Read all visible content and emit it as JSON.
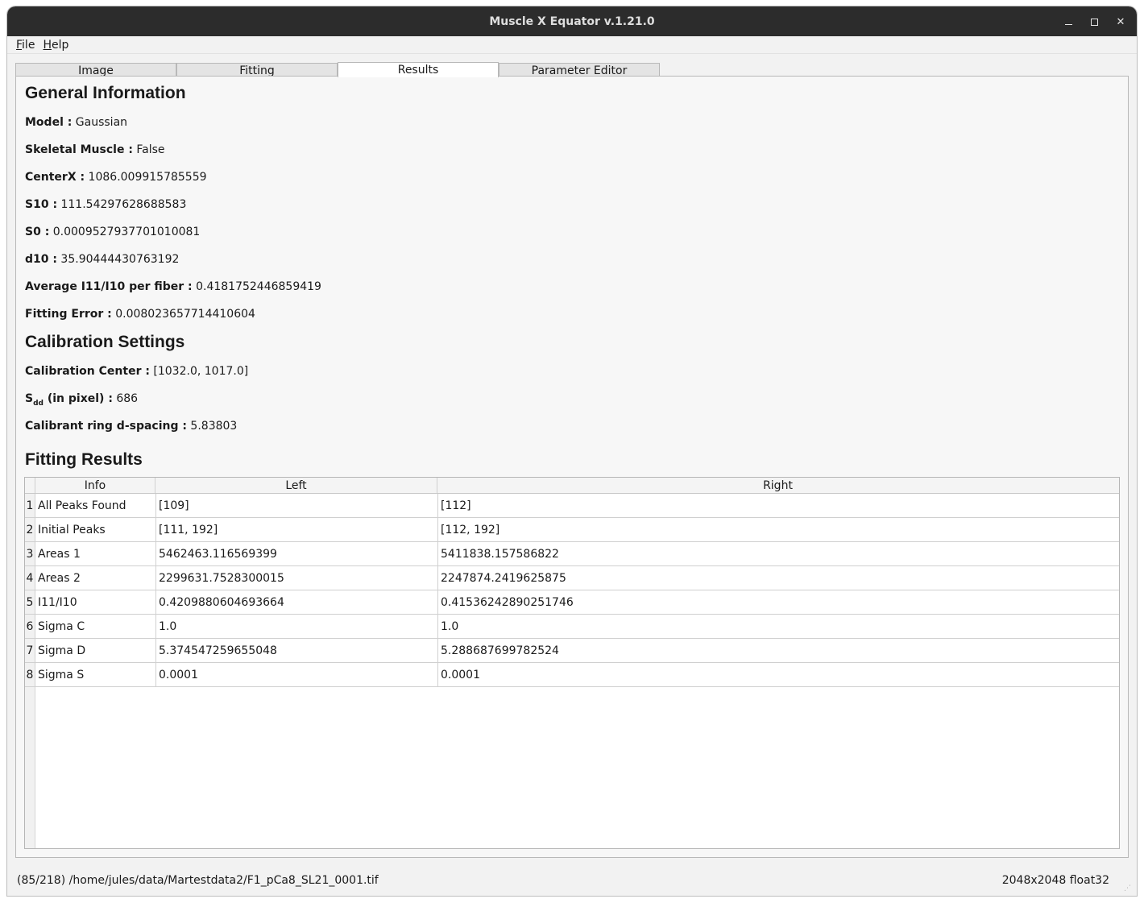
{
  "window": {
    "title": "Muscle X Equator v.1.21.0"
  },
  "menubar": {
    "items": [
      {
        "label": "File",
        "mnemonic": "F",
        "rest": "ile"
      },
      {
        "label": "Help",
        "mnemonic": "H",
        "rest": "elp"
      }
    ]
  },
  "tabs": [
    {
      "label": "Image",
      "active": false
    },
    {
      "label": "Fitting",
      "active": false
    },
    {
      "label": "Results",
      "active": true
    },
    {
      "label": "Parameter Editor",
      "active": false
    }
  ],
  "general": {
    "heading": "General Information",
    "items": [
      {
        "key": "Model :",
        "value": " Gaussian"
      },
      {
        "key": "Skeletal Muscle :",
        "value": " False"
      },
      {
        "key": "CenterX :",
        "value": " 1086.009915785559"
      },
      {
        "key": "S10 :",
        "value": " 111.54297628688583"
      },
      {
        "key": "S0 :",
        "value": " 0.0009527937701010081"
      },
      {
        "key": "d10 :",
        "value": " 35.90444430763192"
      },
      {
        "key": "Average I11/I10 per fiber :",
        "value": " 0.4181752446859419"
      },
      {
        "key": "Fitting Error :",
        "value": " 0.008023657714410604"
      }
    ]
  },
  "calibration": {
    "heading": "Calibration Settings",
    "center_key": "Calibration Center :",
    "center_value": " [1032.0, 1017.0]",
    "sdd_key_main": "S",
    "sdd_key_sub": "dd",
    "sdd_key_rest": " (in pixel) :",
    "sdd_value": " 686",
    "dspacing_key": "Calibrant ring d-spacing :",
    "dspacing_value": " 5.83803"
  },
  "fitting_results": {
    "heading": "Fitting Results",
    "columns": [
      "Info",
      "Left",
      "Right"
    ],
    "rows": [
      {
        "n": "1",
        "info": "All Peaks Found",
        "left": "[109]",
        "right": "[112]"
      },
      {
        "n": "2",
        "info": "Initial Peaks",
        "left": "[111, 192]",
        "right": "[112, 192]"
      },
      {
        "n": "3",
        "info": "Areas 1",
        "left": "5462463.116569399",
        "right": "5411838.157586822"
      },
      {
        "n": "4",
        "info": "Areas 2",
        "left": "2299631.7528300015",
        "right": "2247874.2419625875"
      },
      {
        "n": "5",
        "info": "I11/I10",
        "left": "0.4209880604693664",
        "right": "0.41536242890251746"
      },
      {
        "n": "6",
        "info": "Sigma C",
        "left": "1.0",
        "right": "1.0"
      },
      {
        "n": "7",
        "info": "Sigma D",
        "left": "5.374547259655048",
        "right": "5.288687699782524"
      },
      {
        "n": "8",
        "info": "Sigma S",
        "left": "0.0001",
        "right": "0.0001"
      }
    ]
  },
  "statusbar": {
    "left": "(85/218) /home/jules/data/Martestdata2/F1_pCa8_SL21_0001.tif",
    "right": "2048x2048 float32"
  }
}
